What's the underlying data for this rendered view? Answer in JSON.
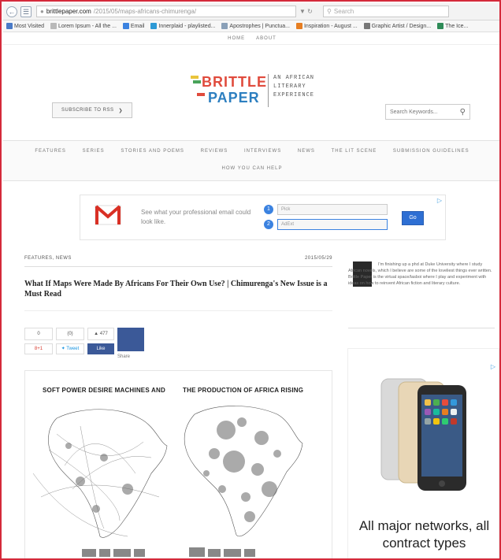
{
  "browser": {
    "address_host": "brittlepaper.com",
    "address_path": "/2015/05/maps-africans-chimurenga/",
    "search_placeholder": "Search",
    "bookmarks": [
      {
        "label": "Most Visited",
        "color": "#4a7ac7"
      },
      {
        "label": "Lorem Ipsum - All the ...",
        "color": "#b9b9b9"
      },
      {
        "label": "Email",
        "color": "#3b82e0"
      },
      {
        "label": "Innerplaid - playlisted...",
        "color": "#2e9ad6"
      },
      {
        "label": "Apostrophes | Punctua...",
        "color": "#8aa0b8"
      },
      {
        "label": "Inspiration - August ...",
        "color": "#e67e22"
      },
      {
        "label": "Graphic Artist / Design...",
        "color": "#777777"
      },
      {
        "label": "The Ice...",
        "color": "#2e8b57"
      }
    ]
  },
  "site": {
    "top_menu": [
      "HOME",
      "ABOUT"
    ],
    "subscribe_label": "SUBSCRIBE TO RSS",
    "logo_line1": "BRITTLE",
    "logo_line2": "PAPER",
    "tagline": [
      "AN AFRICAN",
      "LITERARY",
      "EXPERIENCE"
    ],
    "search_placeholder": "Search Keywords...",
    "nav": [
      "FEATURES",
      "SERIES",
      "STORIES AND POEMS",
      "REVIEWS",
      "INTERVIEWS",
      "NEWS",
      "THE LIT SCENE",
      "SUBMISSION GUIDELINES"
    ],
    "nav_row2": "HOW YOU CAN HELP"
  },
  "ad": {
    "text": "See what your professional email could look like.",
    "field1": "Pick",
    "field2": "AdExt",
    "button": "Go",
    "num1": "1",
    "num2": "2"
  },
  "article": {
    "category": "FEATURES, NEWS",
    "date": "2015/05/29",
    "title": "What If Maps Were Made By Africans For Their Own Use? | Chimurenga's New Issue is a Must Read",
    "share": {
      "count": "0",
      "comments": "(0)",
      "likes": "477",
      "gplus": "8+1",
      "tweet": "Tweet",
      "fb_like": "Like",
      "share": "Share"
    },
    "figure_title_left": "SOFT POWER DESIRE MACHINES AND",
    "figure_title_right": "THE PRODUCTION OF AFRICA RISING"
  },
  "sidebar": {
    "about": "I'm finishing up a phd at Duke University where I study African novels, which I believe are some of the loveliest things ever written. Brittle Paper is the virtual space/lasboi where I play and experiment with ideas on how to reinvent African fiction and literary culture.",
    "phone_ad_text": "All major networks, all contract types"
  },
  "colors": {
    "frame": "#d42a3b",
    "accent": "#3b82e0",
    "facebook": "#3b5998"
  }
}
